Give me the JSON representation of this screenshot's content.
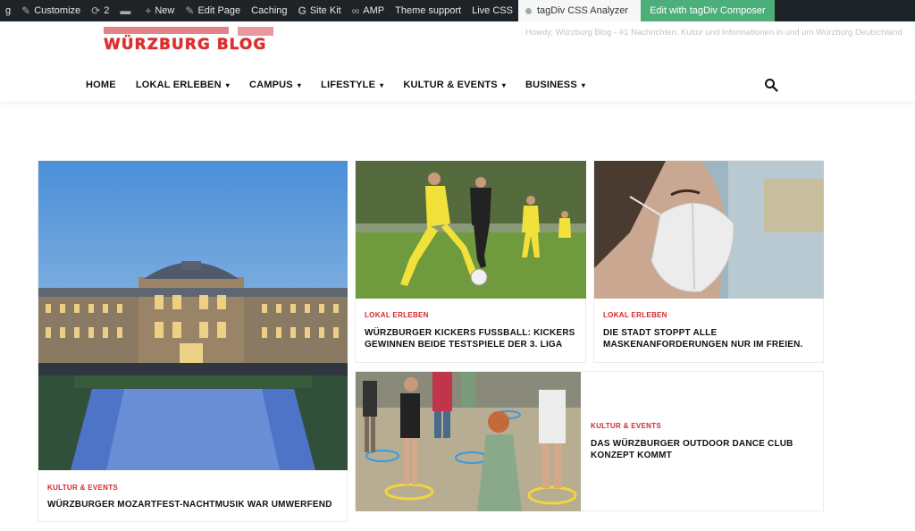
{
  "adminbar": {
    "items": [
      {
        "label": "g"
      },
      {
        "label": "Customize",
        "icon": "brush-icon"
      },
      {
        "label": "2",
        "icon": "refresh-icon"
      },
      {
        "label": "",
        "icon": "comment-icon"
      },
      {
        "label": "New",
        "icon": "plus-icon"
      },
      {
        "label": "Edit Page",
        "icon": "pencil-icon"
      },
      {
        "label": "Caching"
      },
      {
        "label": "Site Kit",
        "icon": "google-icon"
      },
      {
        "label": "AMP",
        "icon": "link-icon"
      },
      {
        "label": "Theme support"
      },
      {
        "label": "Live CSS"
      }
    ],
    "analyzer": "tagDiv CSS Analyzer",
    "composer": "Edit with tagDiv Composer"
  },
  "header": {
    "logo_text": "WÜRZBURG BLOG",
    "tagline": "Howdy, Würzburg Blog - #1 Nachrichten, Kultur und Informationen in und um Würzburg Deutschland",
    "nav": [
      {
        "label": "HOME",
        "dropdown": false
      },
      {
        "label": "LOKAL ERLEBEN",
        "dropdown": true
      },
      {
        "label": "CAMPUS",
        "dropdown": true
      },
      {
        "label": "LIFESTYLE",
        "dropdown": true
      },
      {
        "label": "KULTUR & EVENTS",
        "dropdown": true
      },
      {
        "label": "BUSINESS",
        "dropdown": true
      }
    ]
  },
  "posts": {
    "main": {
      "category": "KULTUR & EVENTS",
      "title": "WÜRZBURGER MOZARTFEST-NACHTMUSIK WAR UMWERFEND"
    },
    "football": {
      "category": "LOKAL ERLEBEN",
      "title": "WÜRZBURGER KICKERS FUSSBALL: KICKERS GEWINNEN BEIDE TESTSPIELE DER 3. LIGA"
    },
    "mask": {
      "category": "LOKAL ERLEBEN",
      "title": "DIE STADT STOPPT ALLE MASKENANFORDERUNGEN NUR IM FREIEN."
    },
    "dance": {
      "category": "KULTUR & EVENTS",
      "title": "DAS WÜRZBURGER OUTDOOR DANCE CLUB KONZEPT KOMMT"
    }
  },
  "colors": {
    "accent": "#d6262b",
    "adminbar": "#1d2327",
    "composer": "#4caf7a"
  }
}
